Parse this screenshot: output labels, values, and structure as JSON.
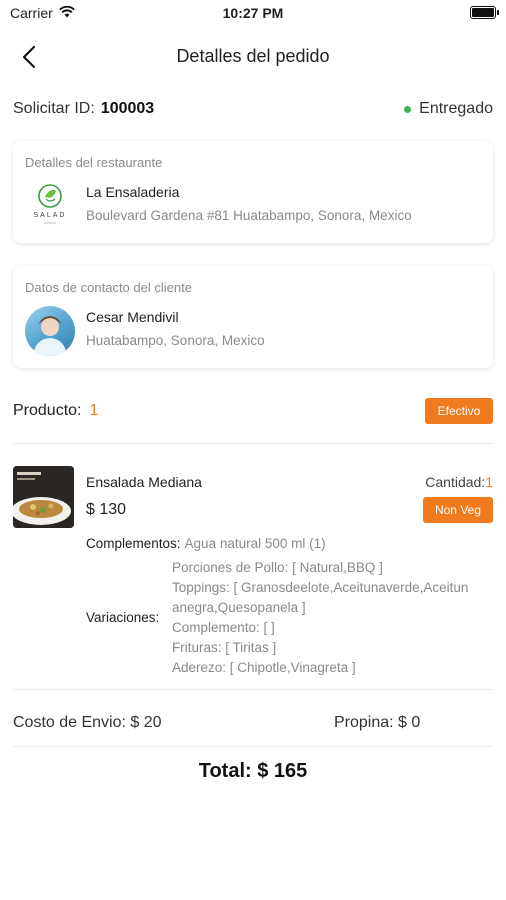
{
  "status_bar": {
    "carrier": "Carrier",
    "time": "10:27 PM"
  },
  "header": {
    "title": "Detalles del pedido"
  },
  "order": {
    "id_label": "Solicitar ID:",
    "id": "100003",
    "status": "Entregado",
    "status_color": "#3cb54a"
  },
  "restaurant": {
    "section_label": "Detalles del restaurante",
    "logo_text": "SALAD",
    "name": "La Ensaladeria",
    "address": "Boulevard Gardena #81 Huatabampo, Sonora, Mexico"
  },
  "customer": {
    "section_label": "Datos de contacto del cliente",
    "name": "Cesar Mendivil",
    "address": "Huatabampo, Sonora, Mexico"
  },
  "product_summary": {
    "label": "Producto:",
    "count": "1",
    "payment_badge": "Efectivo"
  },
  "item": {
    "name": "Ensalada Mediana",
    "price": "$ 130",
    "quantity_label": "Cantidad:",
    "quantity": "1",
    "veg_badge": "Non Veg",
    "complements_label": "Complementos:",
    "complements_value": "Agua natural 500 ml (1)",
    "variations_label": "Variaciones:",
    "variation_lines": [
      "Porciones de Pollo: [ Natural,BBQ ]",
      "Toppings: [ Granosdeelote,Aceitunaverde,Aceitun",
      "anegra,Quesopanela ]",
      "Complemento: [ ]",
      "Frituras: [ Tiritas ]",
      "Aderezo: [ Chipotle,Vinagreta ]"
    ]
  },
  "fees": {
    "delivery": "Costo de Envio: $ 20",
    "tip": "Propina: $ 0"
  },
  "total": "Total: $ 165",
  "colors": {
    "accent": "#f07a1e",
    "status_green": "#3cb54a"
  }
}
